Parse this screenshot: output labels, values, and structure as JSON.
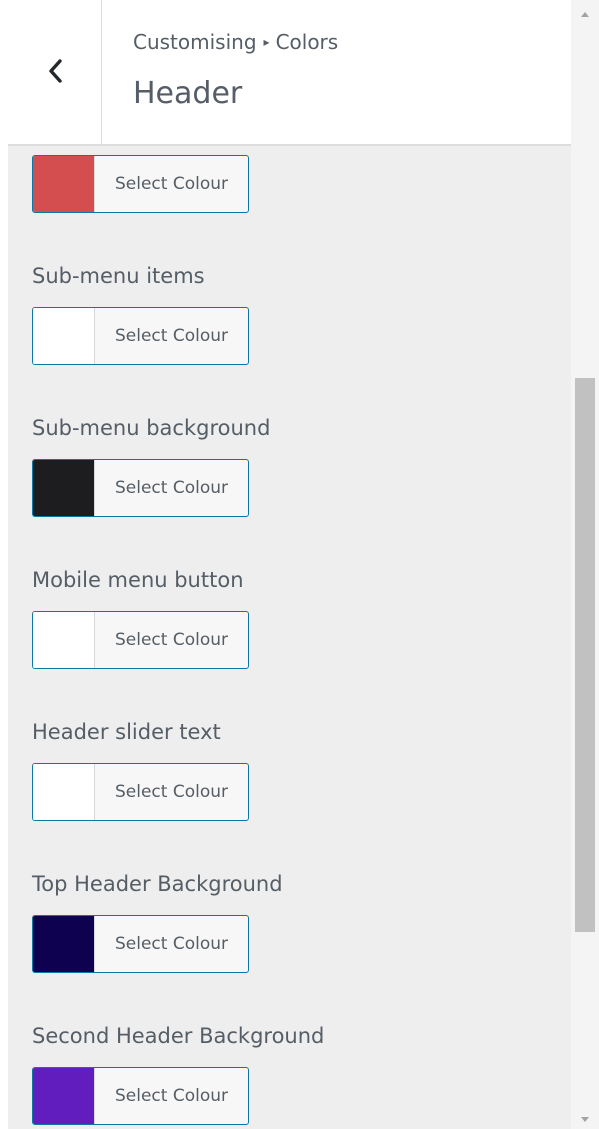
{
  "header": {
    "breadcrumb_parent": "Customising",
    "breadcrumb_separator": "▸",
    "breadcrumb_current": "Colors",
    "title": "Header",
    "back_icon": "chevron-left-icon"
  },
  "colors": {
    "accent_border": "#0e75a5",
    "panel_background": "#eeeeee"
  },
  "controls": [
    {
      "label": "",
      "button_text": "Select Colour",
      "swatch_color": "#d54e4f"
    },
    {
      "label": "Sub-menu items",
      "button_text": "Select Colour",
      "swatch_color": "#ffffff"
    },
    {
      "label": "Sub-menu background",
      "button_text": "Select Colour",
      "swatch_color": "#1d1d1f"
    },
    {
      "label": "Mobile menu button",
      "button_text": "Select Colour",
      "swatch_color": "#ffffff"
    },
    {
      "label": "Header slider text",
      "button_text": "Select Colour",
      "swatch_color": "#ffffff"
    },
    {
      "label": "Top Header Background",
      "button_text": "Select Colour",
      "swatch_color": "#0d0150"
    },
    {
      "label": "Second Header Background",
      "button_text": "Select Colour",
      "swatch_color": "#621dbe"
    }
  ]
}
